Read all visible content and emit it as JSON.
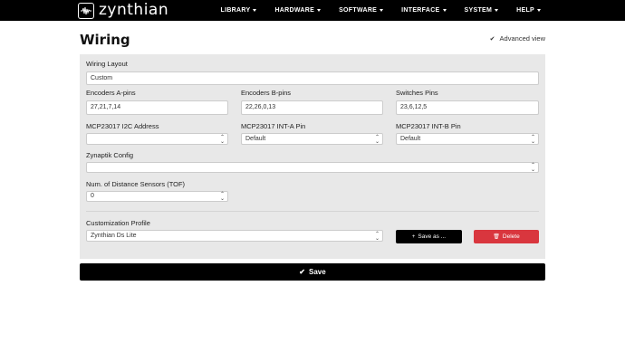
{
  "navbar": {
    "brand": "zynthian",
    "items": [
      {
        "label": "LIBRARY"
      },
      {
        "label": "HARDWARE"
      },
      {
        "label": "SOFTWARE"
      },
      {
        "label": "INTERFACE"
      },
      {
        "label": "SYSTEM"
      },
      {
        "label": "HELP"
      }
    ]
  },
  "page": {
    "title": "Wiring",
    "advanced_check": "✔",
    "advanced_label": "Advanced view"
  },
  "form": {
    "wiring_layout": {
      "label": "Wiring Layout",
      "value": "Custom"
    },
    "encoders_a": {
      "label": "Encoders A-pins",
      "value": "27,21,7,14"
    },
    "encoders_b": {
      "label": "Encoders B-pins",
      "value": "22,26,0,13"
    },
    "switches": {
      "label": "Switches Pins",
      "value": "23,6,12,5"
    },
    "i2c_address": {
      "label": "MCP23017 I2C Address",
      "value": ""
    },
    "int_a": {
      "label": "MCP23017 INT-A Pin",
      "value": "Default"
    },
    "int_b": {
      "label": "MCP23017 INT-B Pin",
      "value": "Default"
    },
    "zynaptik": {
      "label": "Zynaptik Config",
      "value": ""
    },
    "distance": {
      "label": "Num. of Distance Sensors (TOF)",
      "value": "0"
    },
    "profile": {
      "label": "Customization Profile",
      "value": "Zynthian Ds Lite"
    }
  },
  "buttons": {
    "save_as_icon": "+",
    "save_as": "Save as ...",
    "delete_icon": "🗑",
    "delete": "Delete",
    "save_icon": "✔",
    "save": "Save"
  },
  "colors": {
    "navbar": "#000000",
    "panel": "#e8e8e8",
    "delete": "#d9363e"
  }
}
